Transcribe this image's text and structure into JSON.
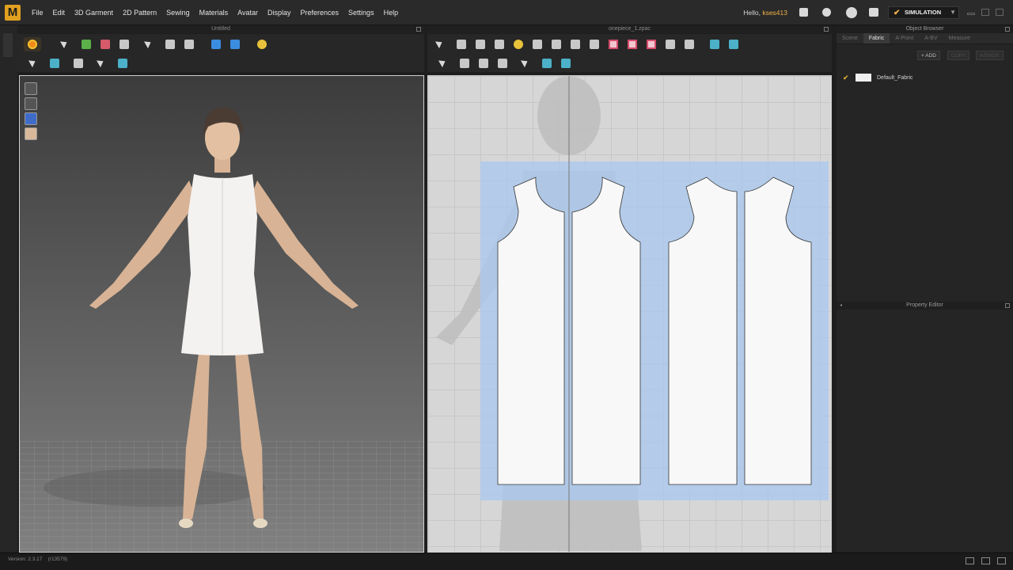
{
  "app": {
    "logo": "M"
  },
  "menu": [
    "File",
    "Edit",
    "3D Garment",
    "2D Pattern",
    "Sewing",
    "Materials",
    "Avatar",
    "Display",
    "Preferences",
    "Settings",
    "Help"
  ],
  "user": {
    "greeting": "Hello,",
    "name": "kses413"
  },
  "mode": {
    "label": "SIMULATION"
  },
  "panels": {
    "left_title": "Untitled",
    "center_title": "onepiece_1.zpac",
    "object_browser": "Object Browser",
    "property_editor": "Property Editor"
  },
  "object_browser": {
    "tabs": [
      "Scene",
      "Fabric",
      "A-Point",
      "A-BV",
      "Measure"
    ],
    "active_tab": "Fabric",
    "actions": {
      "add": "+ ADD",
      "copy": "COPY",
      "assign": "ASSIGN"
    },
    "fabrics": [
      {
        "name": "Default_Fabric",
        "color": "#f0f0f0",
        "selected": true
      }
    ]
  },
  "status": {
    "version": "Version: 2.3.17",
    "build": "(r13579)"
  },
  "colors": {
    "accent": "#f0b24a",
    "pattern_highlight": "#a8c8f0"
  }
}
